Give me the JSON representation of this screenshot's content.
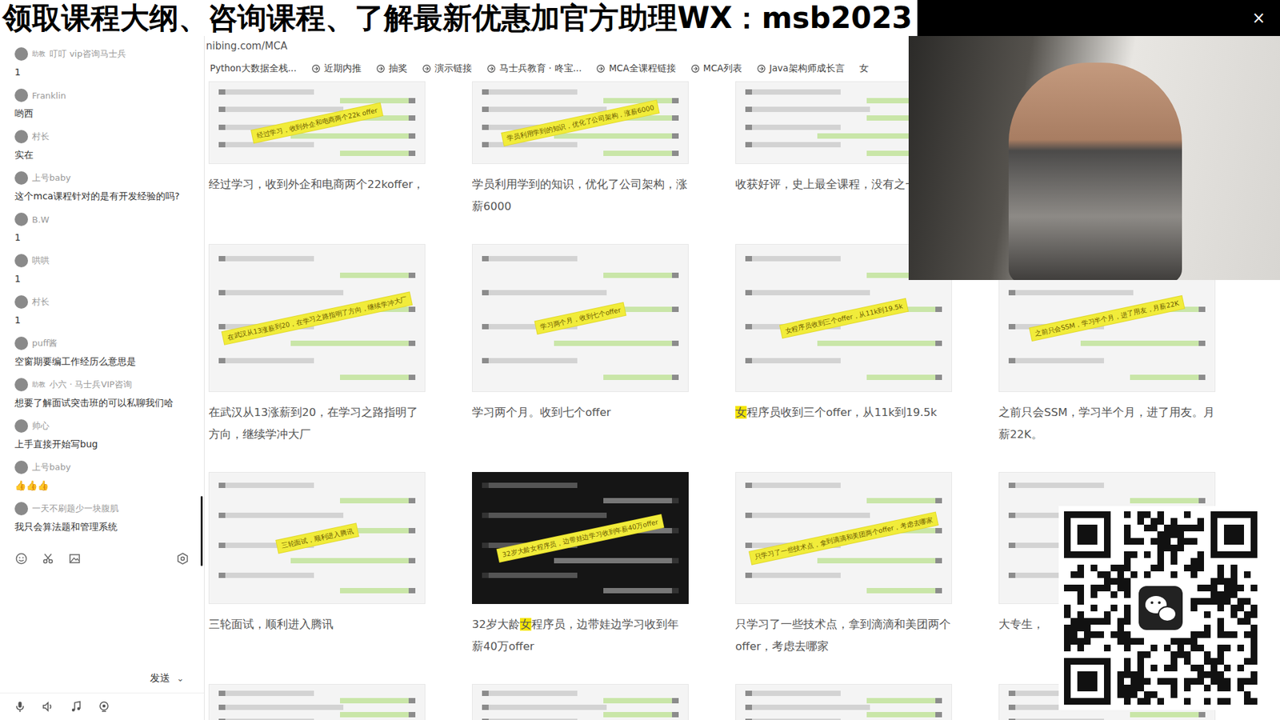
{
  "banner": {
    "text": "领取课程大纲、咨询课程、了解最新优惠加官方助理WX：msb2023",
    "close": "×"
  },
  "chat": {
    "messages": [
      {
        "name": "叮叮 vip咨询马士兵",
        "badge": "助教",
        "text": "1"
      },
      {
        "name": "Franklin",
        "badge": "",
        "text": "哟西"
      },
      {
        "name": "村长",
        "badge": "",
        "text": "实在"
      },
      {
        "name": "上号baby",
        "badge": "",
        "text": "这个mca课程针对的是有开发经验的吗?"
      },
      {
        "name": "B.W",
        "badge": "",
        "text": "1"
      },
      {
        "name": "哄哄",
        "badge": "",
        "text": "1"
      },
      {
        "name": "村长",
        "badge": "",
        "text": "1"
      },
      {
        "name": "puff酱",
        "badge": "",
        "text": "空窗期要编工作经历么意思是"
      },
      {
        "name": "小六 · 马士兵VIP咨询",
        "badge": "助教",
        "text": "想要了解面试突击班的可以私聊我们哈"
      },
      {
        "name": "帅心",
        "badge": "",
        "text": "上手直接开始写bug"
      },
      {
        "name": "上号baby",
        "badge": "",
        "text": "👍👍👍"
      },
      {
        "name": "一天不刷题少一块腹肌",
        "badge": "",
        "text": "我只会算法题和管理系统"
      }
    ],
    "send": "发送",
    "send_menu": "⌄"
  },
  "browser": {
    "url": "nibing.com/MCA",
    "bookmarks": [
      {
        "label": "Python大数据全栈...",
        "icon": false
      },
      {
        "label": "近期内推",
        "icon": true
      },
      {
        "label": "抽奖",
        "icon": true
      },
      {
        "label": "演示链接",
        "icon": true
      },
      {
        "label": "马士兵教育 · 咚宝...",
        "icon": true
      },
      {
        "label": "MCA全课程链接",
        "icon": true
      },
      {
        "label": "MCA列表",
        "icon": true
      },
      {
        "label": "Java架构师成长言",
        "icon": true
      },
      {
        "label": "女",
        "icon": false
      }
    ]
  },
  "cards": [
    [
      {
        "banner": "经过学习，收到外企和电商两个22k offer",
        "caption": "经过学习，收到外企和电商两个22koffer，",
        "highlight": "",
        "kind": "light"
      },
      {
        "banner": "学员利用学到的知识，优化了公司架构，涨薪6000",
        "caption": "学员利用学到的知识，优化了公司架构，涨薪6000",
        "highlight": "",
        "kind": "light"
      },
      {
        "banner": "",
        "caption": "收获好评，史上最全课程，没有之一",
        "highlight": "",
        "kind": "light"
      },
      {
        "banner": "",
        "caption": "",
        "highlight": "",
        "kind": "light"
      }
    ],
    [
      {
        "banner": "在武汉从13涨薪到20，在学习之路指明了方向，继续学冲大厂",
        "caption": "在武汉从13涨薪到20，在学习之路指明了方向，继续学冲大厂",
        "highlight": "",
        "kind": "light"
      },
      {
        "banner": "学习两个月，收到七个offer",
        "caption": "学习两个月。收到七个offer",
        "highlight": "",
        "kind": "light"
      },
      {
        "banner": "女程序员收到三个offer，从11k到19.5k",
        "caption": "女程序员收到三个offer，从11k到19.5k",
        "highlight": "女",
        "kind": "light"
      },
      {
        "banner": "之前只会SSM，学习半个月，进了用友，月薪22K",
        "caption": "之前只会SSM，学习半个月，进了用友。月薪22K。",
        "highlight": "",
        "kind": "light"
      }
    ],
    [
      {
        "banner": "三轮面试，顺利进入腾讯",
        "caption": "三轮面试，顺利进入腾讯",
        "highlight": "",
        "kind": "light"
      },
      {
        "banner": "32岁大龄女程序员，边带娃边学习收到年薪40万offer",
        "caption": "32岁大龄女程序员，边带娃边学习收到年薪40万offer",
        "highlight": "女",
        "kind": "dark"
      },
      {
        "banner": "只学习了一些技术点，拿到滴滴和美团两个offer，考虑去哪家",
        "caption": "只学习了一些技术点，拿到滴滴和美团两个offer，考虑去哪家",
        "highlight": "",
        "kind": "light"
      },
      {
        "banner": "",
        "caption": "大专生，",
        "highlight": "",
        "kind": "light"
      }
    ],
    [
      {
        "banner": "",
        "caption": "",
        "highlight": "",
        "kind": "light"
      },
      {
        "banner": "",
        "caption": "",
        "highlight": "",
        "kind": "light"
      },
      {
        "banner": "",
        "caption": "",
        "highlight": "",
        "kind": "light"
      },
      {
        "banner": "",
        "caption": "",
        "highlight": "",
        "kind": "light"
      }
    ]
  ]
}
